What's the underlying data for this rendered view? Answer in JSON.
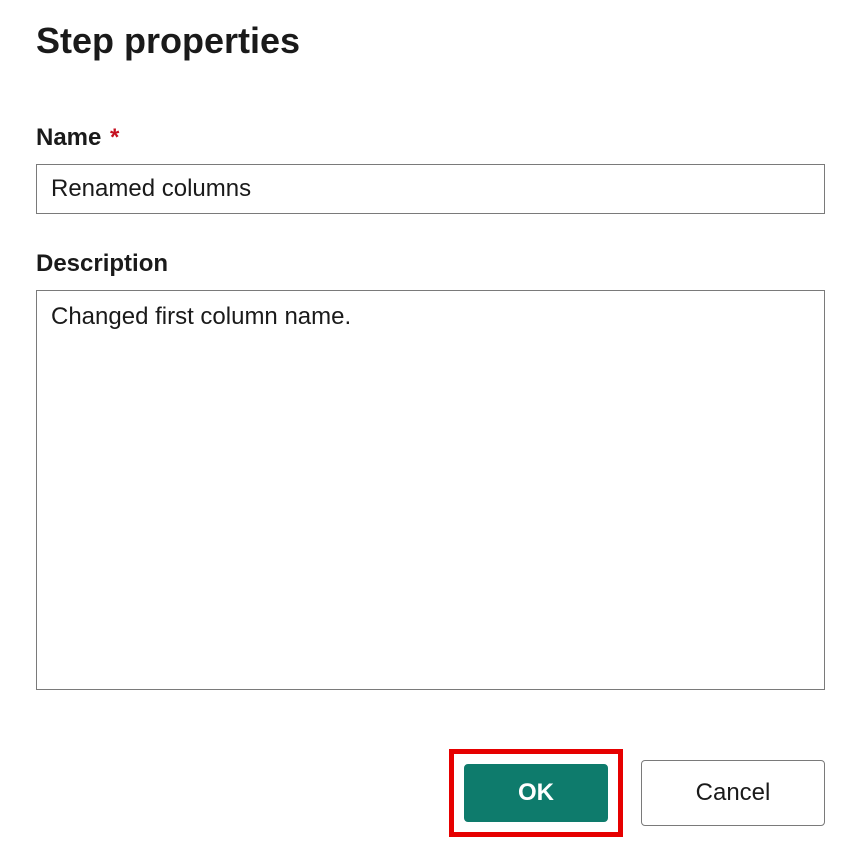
{
  "dialog": {
    "title": "Step properties"
  },
  "form": {
    "name": {
      "label": "Name",
      "required_marker": "*",
      "value": "Renamed columns"
    },
    "description": {
      "label": "Description",
      "value": "Changed first column name."
    }
  },
  "buttons": {
    "ok": "OK",
    "cancel": "Cancel"
  },
  "colors": {
    "primary": "#0e7b6c",
    "required": "#c50f1f",
    "highlight_border": "#e60000"
  }
}
